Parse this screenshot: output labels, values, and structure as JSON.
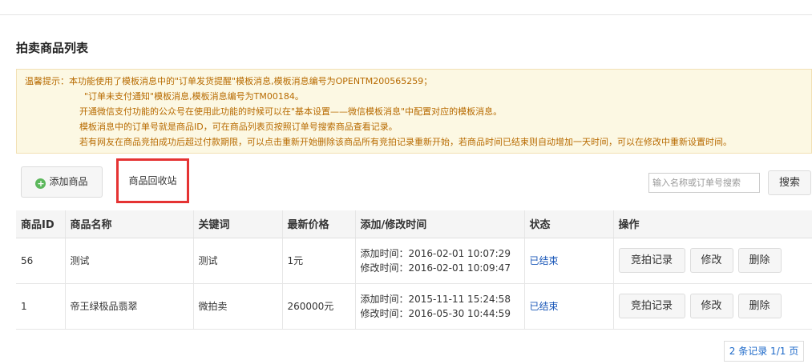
{
  "page": {
    "title": "拍卖商品列表"
  },
  "notice": {
    "lines": [
      "温馨提示：本功能使用了模板消息中的\"订单发货提醒\"模板消息,模板消息编号为OPENTM200565259；",
      "\"订单未支付通知\"模板消息,模板消息编号为TM00184。",
      "开通微信支付功能的公众号在使用此功能的时候可以在\"基本设置——微信模板消息\"中配置对应的模板消息。",
      "模板消息中的订单号就是商品ID，可在商品列表页按照订单号搜索商品查看记录。",
      "若有网友在商品竞拍成功后超过付款期限，可以点击重新开始删除该商品所有竞拍记录重新开始，若商品时间已结束则自动增加一天时间，可以在修改中重新设置时间。"
    ]
  },
  "toolbar": {
    "add_label": "添加商品",
    "add_icon": "plus-circle-icon",
    "recycle_label": "商品回收站",
    "search_placeholder": "输入名称或订单号搜索",
    "search_value": "",
    "search_label": "搜索"
  },
  "table": {
    "headers": [
      "商品ID",
      "商品名称",
      "关键词",
      "最新价格",
      "添加/修改时间",
      "状态",
      "操作"
    ],
    "rows": [
      {
        "id": "56",
        "name": "测试",
        "keyword": "测试",
        "price": "1元",
        "added": "添加时间：2016-02-01 10:07:29",
        "modified": "修改时间：2016-02-01 10:09:47",
        "status": "已结束",
        "actions": [
          "竞拍记录",
          "修改",
          "删除"
        ]
      },
      {
        "id": "1",
        "name": "帝王绿极品翡翠",
        "keyword": "微拍卖",
        "price": "260000元",
        "added": "添加时间：2015-11-11 15:24:58",
        "modified": "修改时间：2016-05-30 10:44:59",
        "status": "已结束",
        "actions": [
          "竞拍记录",
          "修改",
          "删除"
        ]
      }
    ]
  },
  "pagination": {
    "text": "2 条记录 1/1 页"
  },
  "colors": {
    "notice_bg": "#fcf8e3",
    "notice_text": "#b76a00",
    "highlight_border": "#e53333",
    "status_text": "#1a57b8",
    "link": "#1a67c8"
  }
}
